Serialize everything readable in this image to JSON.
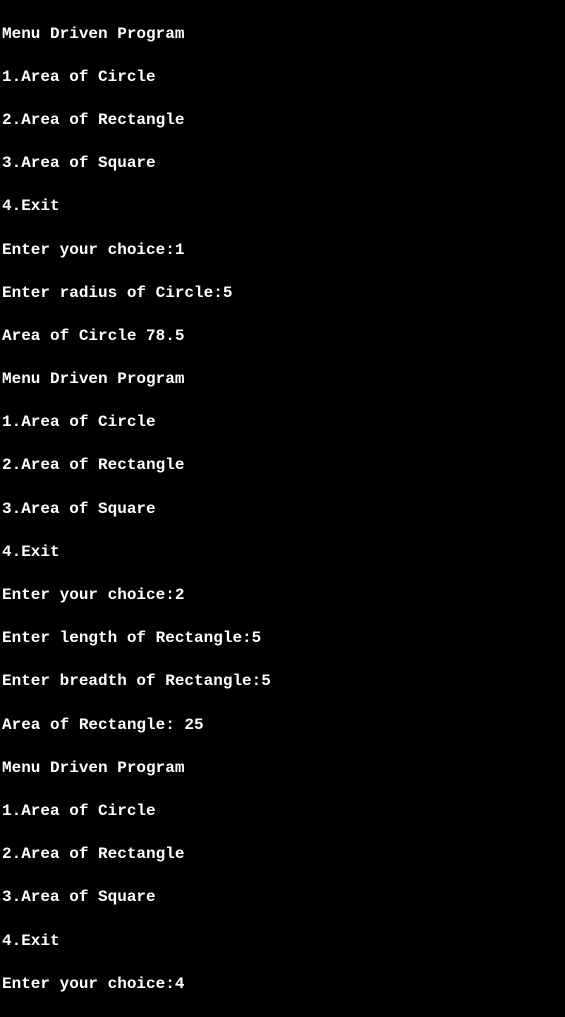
{
  "terminal": {
    "lines": [
      "Menu Driven Program",
      "1.Area of Circle",
      "2.Area of Rectangle",
      "3.Area of Square",
      "4.Exit",
      "Enter your choice:1",
      "Enter radius of Circle:5",
      "Area of Circle 78.5",
      "Menu Driven Program",
      "1.Area of Circle",
      "2.Area of Rectangle",
      "3.Area of Square",
      "4.Exit",
      "Enter your choice:2",
      "Enter length of Rectangle:5",
      "Enter breadth of Rectangle:5",
      "Area of Rectangle: 25",
      "Menu Driven Program",
      "1.Area of Circle",
      "2.Area of Rectangle",
      "3.Area of Square",
      "4.Exit",
      "Enter your choice:4"
    ]
  }
}
